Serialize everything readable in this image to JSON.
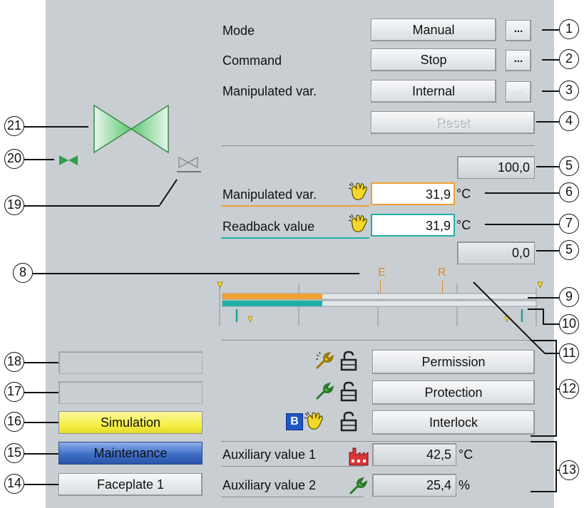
{
  "controls": {
    "mode": {
      "label": "Mode",
      "value": "Manual",
      "more": "..."
    },
    "command": {
      "label": "Command",
      "value": "Stop",
      "more": "..."
    },
    "manipulated": {
      "label": "Manipulated var.",
      "value": "Internal",
      "more": "..."
    },
    "reset": {
      "label": "Reset"
    }
  },
  "analog": {
    "high_limit": "100,0",
    "low_limit": "0,0",
    "manipulated": {
      "label": "Manipulated var.",
      "value": "31,9",
      "unit": "°C"
    },
    "readback": {
      "label": "Readback value",
      "value": "31,9",
      "unit": "°C"
    },
    "scale_markers": {
      "e": "E",
      "r": "R"
    },
    "manipulated_bar_fraction": 0.319,
    "readback_bar_fraction": 0.319
  },
  "buttons": {
    "permission": "Permission",
    "protection": "Protection",
    "interlock": "Interlock",
    "interlock_badge": "B"
  },
  "aux": {
    "aux1": {
      "label": "Auxiliary value 1",
      "value": "42,5",
      "unit": "°C"
    },
    "aux2": {
      "label": "Auxiliary value 2",
      "value": "25,4",
      "unit": "%"
    }
  },
  "status": {
    "simulation": "Simulation",
    "maintenance": "Maintenance",
    "faceplate": "Faceplate 1"
  },
  "callouts": [
    "1",
    "2",
    "3",
    "4",
    "5",
    "6",
    "7",
    "5",
    "8",
    "9",
    "10",
    "11",
    "12",
    "13",
    "14",
    "15",
    "16",
    "17",
    "18",
    "19",
    "20",
    "21"
  ],
  "colors": {
    "panel": "#c9ced3",
    "valve_green": "#5cc873",
    "manipulated_orange": "#f0a030",
    "readback_teal": "#20b0a8",
    "simulation_yellow": "#f6f04a",
    "maintenance_blue": "#3d6fc8"
  }
}
